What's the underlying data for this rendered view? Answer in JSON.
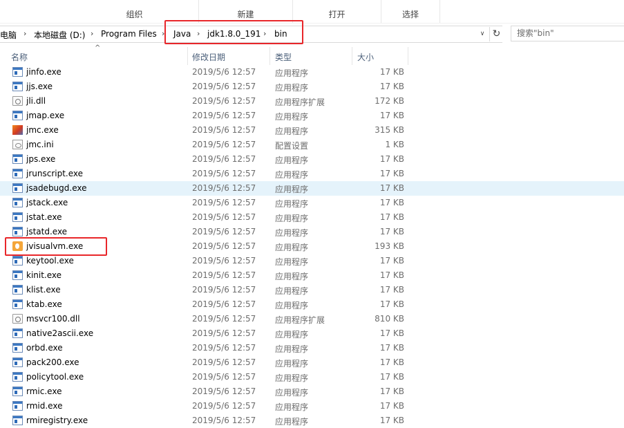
{
  "ribbon": {
    "groups": [
      "组织",
      "新建",
      "打开",
      "选择"
    ]
  },
  "address": {
    "breadcrumb": [
      "电脑",
      "本地磁盘 (D:)",
      "Program Files",
      "Java",
      "jdk1.8.0_191",
      "bin"
    ]
  },
  "search": {
    "placeholder": "搜索\"bin\""
  },
  "columns": {
    "name": "名称",
    "modified": "修改日期",
    "type": "类型",
    "size": "大小"
  },
  "files": [
    {
      "name": "jinfo.exe",
      "date": "2019/5/6 12:57",
      "type": "应用程序",
      "size": "17 KB",
      "icon": "exe-icon"
    },
    {
      "name": "jjs.exe",
      "date": "2019/5/6 12:57",
      "type": "应用程序",
      "size": "17 KB",
      "icon": "exe-icon"
    },
    {
      "name": "jli.dll",
      "date": "2019/5/6 12:57",
      "type": "应用程序扩展",
      "size": "172 KB",
      "icon": "dll-icon"
    },
    {
      "name": "jmap.exe",
      "date": "2019/5/6 12:57",
      "type": "应用程序",
      "size": "17 KB",
      "icon": "exe-icon"
    },
    {
      "name": "jmc.exe",
      "date": "2019/5/6 12:57",
      "type": "应用程序",
      "size": "315 KB",
      "icon": "jmc-icon"
    },
    {
      "name": "jmc.ini",
      "date": "2019/5/6 12:57",
      "type": "配置设置",
      "size": "1 KB",
      "icon": "ini-icon"
    },
    {
      "name": "jps.exe",
      "date": "2019/5/6 12:57",
      "type": "应用程序",
      "size": "17 KB",
      "icon": "exe-icon"
    },
    {
      "name": "jrunscript.exe",
      "date": "2019/5/6 12:57",
      "type": "应用程序",
      "size": "17 KB",
      "icon": "exe-icon"
    },
    {
      "name": "jsadebugd.exe",
      "date": "2019/5/6 12:57",
      "type": "应用程序",
      "size": "17 KB",
      "icon": "exe-icon"
    },
    {
      "name": "jstack.exe",
      "date": "2019/5/6 12:57",
      "type": "应用程序",
      "size": "17 KB",
      "icon": "exe-icon"
    },
    {
      "name": "jstat.exe",
      "date": "2019/5/6 12:57",
      "type": "应用程序",
      "size": "17 KB",
      "icon": "exe-icon"
    },
    {
      "name": "jstatd.exe",
      "date": "2019/5/6 12:57",
      "type": "应用程序",
      "size": "17 KB",
      "icon": "exe-icon"
    },
    {
      "name": "jvisualvm.exe",
      "date": "2019/5/6 12:57",
      "type": "应用程序",
      "size": "193 KB",
      "icon": "jvisualvm-icon"
    },
    {
      "name": "keytool.exe",
      "date": "2019/5/6 12:57",
      "type": "应用程序",
      "size": "17 KB",
      "icon": "exe-icon"
    },
    {
      "name": "kinit.exe",
      "date": "2019/5/6 12:57",
      "type": "应用程序",
      "size": "17 KB",
      "icon": "exe-icon"
    },
    {
      "name": "klist.exe",
      "date": "2019/5/6 12:57",
      "type": "应用程序",
      "size": "17 KB",
      "icon": "exe-icon"
    },
    {
      "name": "ktab.exe",
      "date": "2019/5/6 12:57",
      "type": "应用程序",
      "size": "17 KB",
      "icon": "exe-icon"
    },
    {
      "name": "msvcr100.dll",
      "date": "2019/5/6 12:57",
      "type": "应用程序扩展",
      "size": "810 KB",
      "icon": "dll-icon"
    },
    {
      "name": "native2ascii.exe",
      "date": "2019/5/6 12:57",
      "type": "应用程序",
      "size": "17 KB",
      "icon": "exe-icon"
    },
    {
      "name": "orbd.exe",
      "date": "2019/5/6 12:57",
      "type": "应用程序",
      "size": "17 KB",
      "icon": "exe-icon"
    },
    {
      "name": "pack200.exe",
      "date": "2019/5/6 12:57",
      "type": "应用程序",
      "size": "17 KB",
      "icon": "exe-icon"
    },
    {
      "name": "policytool.exe",
      "date": "2019/5/6 12:57",
      "type": "应用程序",
      "size": "17 KB",
      "icon": "exe-icon"
    },
    {
      "name": "rmic.exe",
      "date": "2019/5/6 12:57",
      "type": "应用程序",
      "size": "17 KB",
      "icon": "exe-icon"
    },
    {
      "name": "rmid.exe",
      "date": "2019/5/6 12:57",
      "type": "应用程序",
      "size": "17 KB",
      "icon": "exe-icon"
    },
    {
      "name": "rmiregistry.exe",
      "date": "2019/5/6 12:57",
      "type": "应用程序",
      "size": "17 KB",
      "icon": "exe-icon"
    }
  ],
  "hover_row": "jsadebugd.exe",
  "highlight_color": "#e8262a",
  "hover_color": "#e5f3fb"
}
